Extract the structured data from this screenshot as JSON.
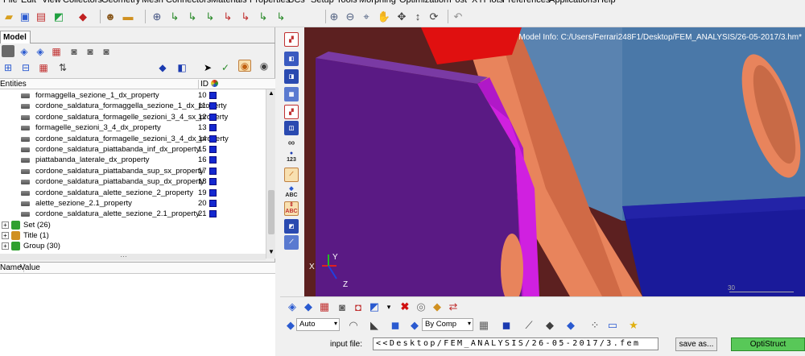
{
  "menubar": [
    "File",
    "Edit",
    "View",
    "Collectors",
    "Geometry",
    "Mesh",
    "Connectors",
    "Materials",
    "Properties",
    "BCs",
    "Setup",
    "Tools",
    "Morphing",
    "Optimization",
    "Post",
    "XYPlots",
    "Preferences",
    "Applications",
    "Help"
  ],
  "left_panel": {
    "tab_label": "Model",
    "entities_header": "Entities",
    "id_header": "ID",
    "properties": [
      {
        "name": "formaggella_sezione_1_dx_property",
        "id": "10"
      },
      {
        "name": "cordone_saldatura_formaggella_sezione_1_dx_property",
        "id": "11"
      },
      {
        "name": "cordone_saldatura_formagelle_sezioni_3_4_sx_property",
        "id": "12"
      },
      {
        "name": "formagelle_sezioni_3_4_dx_property",
        "id": "13"
      },
      {
        "name": "cordone_saldatura_formagelle_sezioni_3_4_dx_property",
        "id": "14"
      },
      {
        "name": "cordone_saldatura_piattabanda_inf_dx_property",
        "id": "15"
      },
      {
        "name": "piattabanda_laterale_dx_property",
        "id": "16"
      },
      {
        "name": "cordone_saldatura_piattabanda_sup_sx_property",
        "id": "17"
      },
      {
        "name": "cordone_saldatura_piattabanda_sup_dx_property",
        "id": "18"
      },
      {
        "name": "cordone_saldatura_alette_sezione_2_property",
        "id": "19"
      },
      {
        "name": "alette_sezione_2.1_property",
        "id": "20"
      },
      {
        "name": "cordone_saldatura_alette_sezione_2.1_property",
        "id": "21"
      }
    ],
    "groups": [
      {
        "label": "Set (26)",
        "icon": "set-icon"
      },
      {
        "label": "Title (1)",
        "icon": "title-icon"
      },
      {
        "label": "Group (30)",
        "icon": "group-icon"
      }
    ],
    "name_header": "Name",
    "value_header": "Value"
  },
  "viewport": {
    "model_info": "Model Info: C:/Users/Ferrari248F1/Desktop/FEM_ANALYSIS/26-05-2017/3.hm*",
    "axis_x": "X",
    "axis_y": "Y",
    "axis_z": "Z",
    "scale_label": "30"
  },
  "vertical_toolbar": {
    "label_123": "123",
    "label_abc": "ABC"
  },
  "bottom": {
    "display_mode": "Auto",
    "color_mode": "By Comp",
    "input_label": "input file:",
    "input_value": "<<Desktop/FEM_ANALYSIS/26-05-2017/3.fem",
    "save_as_label": "save as...",
    "solver_label": "OptiStruct"
  },
  "colors": {
    "viewport_bg": "#5c2020",
    "part_red": "#e01010",
    "part_purple": "#5a1a84",
    "part_magenta": "#d020e0",
    "part_salmon": "#e8845c",
    "part_blue": "#1a1a9a",
    "part_steel": "#4a78a8",
    "property_swatch": "#1428d0",
    "solver_green": "#58c858"
  }
}
